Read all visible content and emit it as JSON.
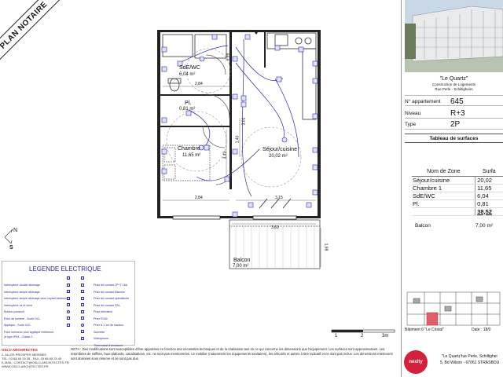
{
  "ribbon": {
    "text": "PLAN NOTAIRE"
  },
  "project": {
    "name": "\"Le Quartz\"",
    "line1": "Construction de Logements",
    "line2": "Rue Perle - Schiltigheim"
  },
  "apartment": {
    "rows": [
      {
        "label": "N° appartement",
        "value": "645"
      },
      {
        "label": "Niveau",
        "value": "R+3"
      },
      {
        "label": "Type",
        "value": "2P"
      }
    ]
  },
  "surfaces": {
    "title": "Tableau de surfaces",
    "col_zone": "Nom de Zone",
    "col_surface": "Surfa",
    "rows": [
      {
        "name": "Séjour/cuisine",
        "value": "20,02"
      },
      {
        "name": "Chambre 1",
        "value": "11,65"
      },
      {
        "name": "SdE/WC",
        "value": "6,04"
      },
      {
        "name": "Pl.",
        "value": "0,81"
      }
    ],
    "total": "38,52",
    "balcony_label": "Balcon",
    "balcony_value": "7,00 m²"
  },
  "plan": {
    "rooms": [
      {
        "name": "SdE/WC",
        "area": "6,04 m²"
      },
      {
        "name": "Pl.",
        "area": "0,81 m²"
      },
      {
        "name": "Chambre",
        "area": "11,65 m²"
      },
      {
        "name": "Séjour/cuisine",
        "area": "20,02 m²"
      },
      {
        "name": "Balcon",
        "area": "7,00 m²"
      }
    ],
    "dimensions": [
      "2,84",
      "2,84",
      "3,15",
      "3,69",
      "1,98",
      "3,40",
      "1,40",
      "3,01",
      "0,99"
    ],
    "compass_letters": [
      "N",
      "S"
    ]
  },
  "legend": {
    "title": "LEGENDE ELECTRIQUE",
    "left_items": [
      "Interrupteur double allumage",
      "Interrupteur simple allumage",
      "Interrupteur simple allumage avec voyant lumineux",
      "Interrupteur va et vient",
      "Bouton poussoir",
      "Point de lumière - Socle DCL",
      "Applique - Socle DCL",
      "Point lumineux pour applique extérieure",
      "(à type IP44 - Classe 2"
    ],
    "right_items": [
      "Prise de courant 2P+T 16A",
      "Prise de courant Blanche",
      "Prise de courant spécialisée",
      "Prise de courant 32A",
      "Prise télévision",
      "Prise RJ45",
      "Prise à 1.1m de hauteur",
      "Sonnette",
      "Vidéophone",
      "Thermostat d'ambiance"
    ]
  },
  "scale": {
    "labels": [
      "1",
      "2",
      "3m"
    ]
  },
  "keyplan": {
    "label": "Bâtiment 6 \"Le Cristal\"",
    "date": "Date : 18/0"
  },
  "footer": {
    "firm_name": "OSLO ARCHITECTES",
    "firm_lines": [
      "2, ALLEE PROSPER MERIMEE",
      "TEL: 03 88 65 25 35 - FAX: 03 88 65 25 45",
      "E-MAIL: CONTACT@OSLO-ARCHITECTES.FR",
      "WWW.OSLO-ARCHITECTES.FR"
    ],
    "note": "NOTA : Des modifications sont susceptibles d'être apportées en fonction des nécessités techniques et de la réalisation tant en ce qui concerne les dimensions que l'équipement. Les surfaces sont approximatives. Les retombées de soffites, faux-plafonds, canalisations, etc. ne sont pas mentionnées. Le mobilier (notamment les équipements sanitaires), les articulés et autres à titre indicatif et ne sont pas inclus. Les dimensions intérieures sont données sous réserve et ne sont pas dus.",
    "developer_name": "\"Le Quartz\"",
    "developer_line1": ", rue Perle, Schiltighei",
    "developer_line2": "5, Bd Wilson - 67061 STRASBOU",
    "nexity_label": "nexity"
  },
  "colors": {
    "electrical": "#2a2a9a",
    "nexity": "#d4203a",
    "keyplan_highlight": "#e0606a"
  }
}
